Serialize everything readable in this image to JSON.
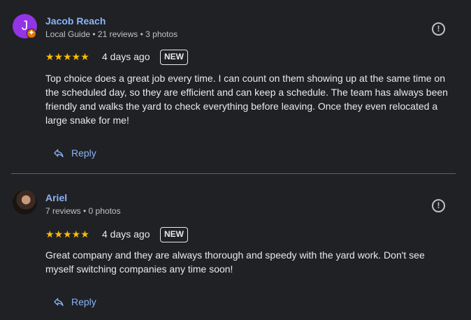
{
  "reviews": [
    {
      "author": "Jacob Reach",
      "avatar_initial": "J",
      "meta": "Local Guide • 21 reviews • 3 photos",
      "stars": "★★★★★",
      "date": "4 days ago",
      "badge": "NEW",
      "text": "Top choice does a great job every time. I can count on them showing up at the same time on the scheduled day, so they are efficient and can keep a schedule. The team has always been friendly and walks the yard to check everything before leaving. Once they even relocated a large snake for me!",
      "reply_label": "Reply"
    },
    {
      "author": "Ariel",
      "meta": "7 reviews • 0 photos",
      "stars": "★★★★★",
      "date": "4 days ago",
      "badge": "NEW",
      "text": "Great company and they are always thorough and speedy with the yard work. Don't see myself switching companies any time soon!",
      "reply_label": "Reply"
    }
  ],
  "colors": {
    "background": "#202124",
    "link": "#8ab4f8",
    "star": "#fbbc04",
    "avatar_purple": "#9334e6",
    "local_guide_badge": "#e37400"
  },
  "icons": {
    "report": "report-icon",
    "reply": "reply-arrow-icon",
    "local_guide": "local-guide-badge-icon"
  }
}
